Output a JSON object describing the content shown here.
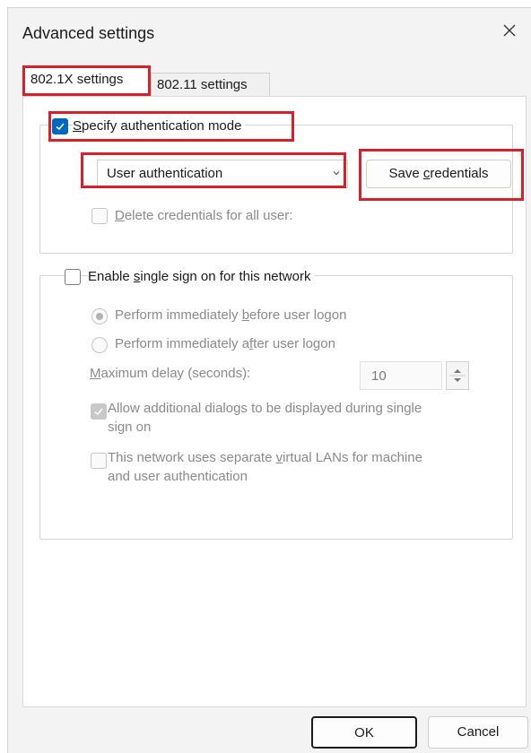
{
  "dialog": {
    "title": "Advanced settings",
    "close_icon": "close-icon"
  },
  "tabs": [
    {
      "label": "802.1X settings",
      "active": true
    },
    {
      "label": "802.11 settings",
      "active": false
    }
  ],
  "auth_group": {
    "specify_mode": {
      "label_pre": "",
      "label_ul": "S",
      "label_post": "pecify authentication mode",
      "checked": true
    },
    "mode_select": {
      "value": "User authentication"
    },
    "save_button": {
      "label_pre": "Save ",
      "label_ul": "c",
      "label_post": "redentials"
    },
    "delete_creds": {
      "label_pre": "",
      "label_ul": "D",
      "label_post": "elete credentials for all user:",
      "checked": false,
      "disabled": true
    }
  },
  "sso_group": {
    "enable": {
      "label_pre": "Enable ",
      "label_ul": "s",
      "label_post": "ingle sign on for this network",
      "checked": false
    },
    "radio_before": {
      "label_pre": "Perform immediately ",
      "label_ul": "b",
      "label_post": "efore user logon",
      "selected": true
    },
    "radio_after": {
      "label_pre": "Perform immediately a",
      "label_ul": "f",
      "label_post": "ter user logon",
      "selected": false
    },
    "max_delay": {
      "label_pre": "",
      "label_ul": "M",
      "label_post": "aximum delay (seconds):",
      "value": "10"
    },
    "allow_dialogs": {
      "line1": "Allow additional dialogs to be displayed during single",
      "line2": "sign on",
      "checked": true
    },
    "separate_vlans": {
      "line1_pre": "This network uses separate ",
      "line1_ul": "v",
      "line1_post": "irtual LANs for machine",
      "line2": "and user authentication",
      "checked": false
    }
  },
  "footer": {
    "ok": "OK",
    "cancel": "Cancel"
  },
  "colors": {
    "accent": "#0067c0",
    "highlight": "#d8202b"
  }
}
